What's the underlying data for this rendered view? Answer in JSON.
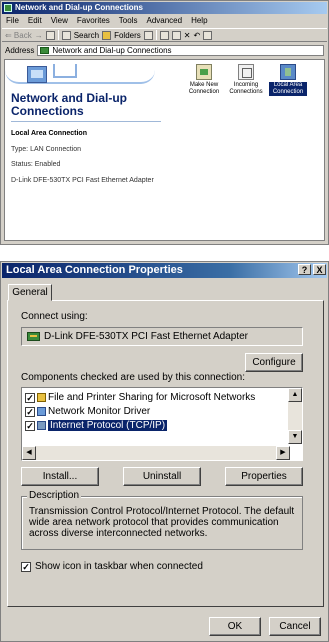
{
  "explorer": {
    "title": "Network and Dial-up Connections",
    "menu": [
      "File",
      "Edit",
      "View",
      "Favorites",
      "Tools",
      "Advanced",
      "Help"
    ],
    "toolbar": {
      "back": "⇐ Back",
      "search": "Search",
      "folders": "Folders"
    },
    "address_label": "Address",
    "address_value": "Network and Dial-up Connections",
    "sidebar": {
      "heading": "Network and Dial-up Connections",
      "item_title": "Local Area Connection",
      "type_text": "Type: LAN Connection",
      "status_text": "Status: Enabled",
      "device_text": "D-Link DFE-530TX PCI Fast Ethernet Adapter"
    },
    "icons": [
      {
        "label": "Make New Connection",
        "icon": "make-new-connection-icon"
      },
      {
        "label": "Incoming Connections",
        "icon": "incoming-connections-icon"
      },
      {
        "label": "Local Area Connection",
        "icon": "local-area-connection-icon",
        "selected": true
      }
    ]
  },
  "dialog": {
    "title": "Local Area Connection Properties",
    "help_btn": "?",
    "close_btn": "X",
    "tab": "General",
    "connect_using_label": "Connect using:",
    "adapter": "D-Link DFE-530TX PCI Fast Ethernet Adapter",
    "configure_btn": "Configure",
    "components_label": "Components checked are used by this connection:",
    "components": [
      {
        "label": "File and Printer Sharing for Microsoft Networks",
        "checked": true,
        "icon": "sharing-icon"
      },
      {
        "label": "Network Monitor Driver",
        "checked": true,
        "icon": "network-driver-icon"
      },
      {
        "label": "Internet Protocol (TCP/IP)",
        "checked": true,
        "selected": true,
        "icon": "protocol-icon"
      }
    ],
    "install_btn": "Install...",
    "uninstall_btn": "Uninstall",
    "properties_btn": "Properties",
    "description_legend": "Description",
    "description_text": "Transmission Control Protocol/Internet Protocol. The default wide area network protocol that provides communication across diverse interconnected networks.",
    "show_icon_label": "Show icon in taskbar when connected",
    "show_icon_checked": true,
    "ok_btn": "OK",
    "cancel_btn": "Cancel"
  }
}
